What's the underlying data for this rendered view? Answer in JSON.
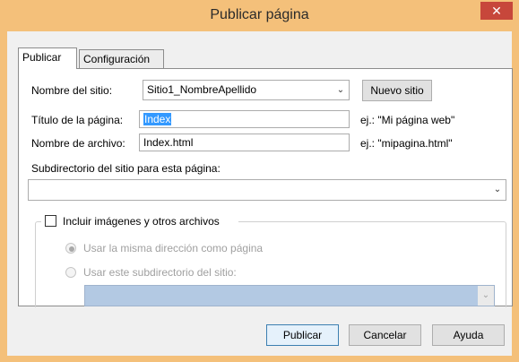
{
  "window": {
    "title": "Publicar página",
    "close": "✕"
  },
  "tabs": [
    {
      "label": "Publicar"
    },
    {
      "label": "Configuración"
    }
  ],
  "form": {
    "site_name_label": "Nombre del sitio:",
    "site_name_value": "Sitio1_NombreApellido",
    "new_site_label": "Nuevo sitio",
    "page_title_label": "Título de la página:",
    "page_title_value": "Index",
    "page_title_hint": "ej.: \"Mi página web\"",
    "file_name_label": "Nombre de archivo:",
    "file_name_value": "Index.html",
    "file_name_hint": "ej.: \"mipagina.html\"",
    "subdir_label": "Subdirectorio del sitio para esta página:",
    "subdir_value": ""
  },
  "include_group": {
    "checkbox_label": "Incluir imágenes y otros archivos",
    "checked": false,
    "option_same": "Usar la misma dirección como página",
    "option_subdir": "Usar este subdirectorio del sitio:",
    "subdir_value": ""
  },
  "buttons": {
    "publish": "Publicar",
    "cancel": "Cancelar",
    "help": "Ayuda"
  },
  "icons": {
    "dropdown": "chevron-down-icon",
    "close": "close-icon"
  }
}
